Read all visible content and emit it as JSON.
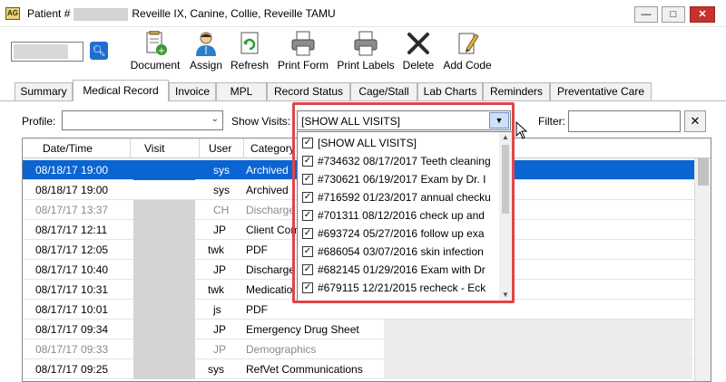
{
  "window": {
    "title_prefix": "Patient #",
    "title_suffix": "Reveille IX, Canine, Collie, Reveille TAMU",
    "min_glyph": "—",
    "max_glyph": "□",
    "close_glyph": "✕"
  },
  "toolbar": {
    "buttons": [
      {
        "label": "Document",
        "icon": "document-add-icon"
      },
      {
        "label": "Assign",
        "icon": "doctor-icon"
      },
      {
        "label": "Refresh",
        "icon": "refresh-icon"
      },
      {
        "label": "Print Form",
        "icon": "printer-icon"
      },
      {
        "label": "Print Labels",
        "icon": "printer-icon"
      },
      {
        "label": "Delete",
        "icon": "delete-x-icon"
      },
      {
        "label": "Add Code",
        "icon": "pencil-document-icon"
      }
    ]
  },
  "tabs": [
    {
      "label": "Summary"
    },
    {
      "label": "Medical Record",
      "active": true
    },
    {
      "label": "Invoice"
    },
    {
      "label": "MPL"
    },
    {
      "label": "Record Status"
    },
    {
      "label": "Cage/Stall"
    },
    {
      "label": "Lab Charts"
    },
    {
      "label": "Reminders"
    },
    {
      "label": "Preventative Care"
    }
  ],
  "filters": {
    "profile_label": "Profile:",
    "profile_value": "",
    "show_visits_label": "Show Visits:",
    "show_visits_value": "[SHOW ALL VISITS]",
    "filter_label": "Filter:",
    "filter_value": "",
    "clear_glyph": "✕"
  },
  "grid": {
    "columns": [
      "Date/Time",
      "Visit",
      "User",
      "Category"
    ],
    "rows": [
      {
        "date": "08/18/17 19:00",
        "user": "sys",
        "category": "Archived",
        "selected": true
      },
      {
        "date": "08/18/17 19:00",
        "user": "sys",
        "category": "Archived"
      },
      {
        "date": "08/17/17 13:37",
        "user": "CH",
        "category": "Discharge",
        "gray": true
      },
      {
        "date": "08/17/17 12:11",
        "user": "JP",
        "category": "Client Com"
      },
      {
        "date": "08/17/17 12:05",
        "user": "twk",
        "category": "PDF"
      },
      {
        "date": "08/17/17 10:40",
        "user": "JP",
        "category": "Discharge"
      },
      {
        "date": "08/17/17 10:31",
        "user": "twk",
        "category": "Medicatio"
      },
      {
        "date": "08/17/17 10:01",
        "user": "js",
        "category": "PDF"
      },
      {
        "date": "08/17/17 09:34",
        "user": "JP",
        "category": "Emergency Drug Sheet"
      },
      {
        "date": "08/17/17 09:33",
        "user": "JP",
        "category": "Demographics",
        "gray": true
      },
      {
        "date": "08/17/17 09:25",
        "user": "sys",
        "category": "RefVet Communications"
      }
    ]
  },
  "visits_dropdown": {
    "items": [
      "[SHOW ALL VISITS]",
      "#734632 08/17/2017 Teeth cleaning",
      "#730621 06/19/2017 Exam by Dr. I",
      "#716592 01/23/2017 annual checku",
      "#701311 08/12/2016 check up and",
      "#693724 05/27/2016 follow up exa",
      "#686054 03/07/2016 skin infection",
      "#682145 01/29/2016 Exam with Dr",
      "#679115 12/21/2015 recheck - Eck"
    ],
    "check_glyph": "✓"
  },
  "colors": {
    "selection": "#0a64d2",
    "highlight_border": "#e0454b"
  }
}
